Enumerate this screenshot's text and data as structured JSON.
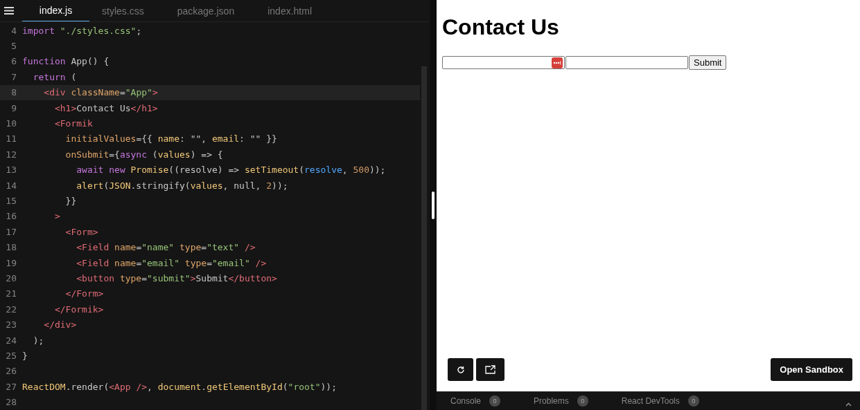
{
  "editor": {
    "tabs": [
      {
        "label": "index.js",
        "selected": true
      },
      {
        "label": "styles.css",
        "selected": false
      },
      {
        "label": "package.json",
        "selected": false
      },
      {
        "label": "index.html",
        "selected": false
      }
    ],
    "lines": [
      {
        "number": "4",
        "highlighted": false,
        "tokens": [
          {
            "text": "import ",
            "kind": "kw"
          },
          {
            "text": "\"./styles.css\"",
            "kind": "str"
          },
          {
            "text": ";",
            "kind": "plain"
          }
        ]
      },
      {
        "number": "5",
        "highlighted": false
      },
      {
        "number": "6",
        "highlighted": false,
        "tokens": [
          {
            "text": "function",
            "kind": "kw"
          },
          {
            "text": " App() {",
            "kind": "plain"
          }
        ]
      },
      {
        "number": "7",
        "highlighted": false,
        "tokens": [
          {
            "text": "  return",
            "kind": "kw"
          },
          {
            "text": " (",
            "kind": "plain"
          }
        ]
      },
      {
        "number": "8",
        "highlighted": true,
        "tokens": [
          {
            "text": "    <div",
            "kind": "tag"
          },
          {
            "text": " className",
            "kind": "attr"
          },
          {
            "text": "=",
            "kind": "plain"
          },
          {
            "text": "\"App\"",
            "kind": "str"
          },
          {
            "text": ">",
            "kind": "tag"
          }
        ]
      },
      {
        "number": "9",
        "highlighted": false,
        "tokens": [
          {
            "text": "      <h1>",
            "kind": "tag"
          },
          {
            "text": "Contact Us",
            "kind": "plain"
          },
          {
            "text": "</h1>",
            "kind": "tag"
          }
        ]
      },
      {
        "number": "10",
        "highlighted": false,
        "tokens": [
          {
            "text": "      <Formik",
            "kind": "tag"
          }
        ]
      },
      {
        "number": "11",
        "highlighted": false,
        "tokens": [
          {
            "text": "        initialValues",
            "kind": "attr"
          },
          {
            "text": "={{ ",
            "kind": "plain"
          },
          {
            "text": "name",
            "kind": "fn"
          },
          {
            "text": ": \"\", ",
            "kind": "plain"
          },
          {
            "text": "email",
            "kind": "fn"
          },
          {
            "text": ": \"\" }}",
            "kind": "plain"
          }
        ]
      },
      {
        "number": "12",
        "highlighted": false,
        "tokens": [
          {
            "text": "        onSubmit",
            "kind": "attr"
          },
          {
            "text": "={",
            "kind": "plain"
          },
          {
            "text": "async",
            "kind": "kw"
          },
          {
            "text": " (",
            "kind": "plain"
          },
          {
            "text": "values",
            "kind": "fn"
          },
          {
            "text": ") => {",
            "kind": "plain"
          }
        ]
      },
      {
        "number": "13",
        "highlighted": false,
        "tokens": [
          {
            "text": "          await new ",
            "kind": "kw"
          },
          {
            "text": "Promise",
            "kind": "fn"
          },
          {
            "text": "((resolve) => ",
            "kind": "plain"
          },
          {
            "text": "setTimeout",
            "kind": "fn"
          },
          {
            "text": "(",
            "kind": "plain"
          },
          {
            "text": "resolve",
            "kind": "var"
          },
          {
            "text": ", ",
            "kind": "plain"
          },
          {
            "text": "500",
            "kind": "num"
          },
          {
            "text": "));",
            "kind": "plain"
          }
        ]
      },
      {
        "number": "14",
        "highlighted": false,
        "tokens": [
          {
            "text": "          alert",
            "kind": "fn"
          },
          {
            "text": "(",
            "kind": "plain"
          },
          {
            "text": "JSON",
            "kind": "fn"
          },
          {
            "text": ".stringify(",
            "kind": "plain"
          },
          {
            "text": "values",
            "kind": "fn"
          },
          {
            "text": ", null, ",
            "kind": "plain"
          },
          {
            "text": "2",
            "kind": "num"
          },
          {
            "text": "));",
            "kind": "plain"
          }
        ]
      },
      {
        "number": "15",
        "highlighted": false,
        "tokens": [
          {
            "text": "        }}",
            "kind": "plain"
          }
        ]
      },
      {
        "number": "16",
        "highlighted": false,
        "tokens": [
          {
            "text": "      >",
            "kind": "tag"
          }
        ]
      },
      {
        "number": "17",
        "highlighted": false,
        "tokens": [
          {
            "text": "        <Form>",
            "kind": "tag"
          }
        ]
      },
      {
        "number": "18",
        "highlighted": false,
        "tokens": [
          {
            "text": "          <Field",
            "kind": "tag"
          },
          {
            "text": " name",
            "kind": "attr"
          },
          {
            "text": "=",
            "kind": "plain"
          },
          {
            "text": "\"name\"",
            "kind": "str"
          },
          {
            "text": " type",
            "kind": "attr"
          },
          {
            "text": "=",
            "kind": "plain"
          },
          {
            "text": "\"text\"",
            "kind": "str"
          },
          {
            "text": " />",
            "kind": "tag"
          }
        ]
      },
      {
        "number": "19",
        "highlighted": false,
        "tokens": [
          {
            "text": "          <Field",
            "kind": "tag"
          },
          {
            "text": " name",
            "kind": "attr"
          },
          {
            "text": "=",
            "kind": "plain"
          },
          {
            "text": "\"email\"",
            "kind": "str"
          },
          {
            "text": " type",
            "kind": "attr"
          },
          {
            "text": "=",
            "kind": "plain"
          },
          {
            "text": "\"email\"",
            "kind": "str"
          },
          {
            "text": " />",
            "kind": "tag"
          }
        ]
      },
      {
        "number": "20",
        "highlighted": false,
        "tokens": [
          {
            "text": "          <button",
            "kind": "tag"
          },
          {
            "text": " type",
            "kind": "attr"
          },
          {
            "text": "=",
            "kind": "plain"
          },
          {
            "text": "\"submit\"",
            "kind": "str"
          },
          {
            "text": ">",
            "kind": "tag"
          },
          {
            "text": "Submit",
            "kind": "plain"
          },
          {
            "text": "</button>",
            "kind": "tag"
          }
        ]
      },
      {
        "number": "21",
        "highlighted": false,
        "tokens": [
          {
            "text": "        </Form>",
            "kind": "tag"
          }
        ]
      },
      {
        "number": "22",
        "highlighted": false,
        "tokens": [
          {
            "text": "      </Formik>",
            "kind": "tag"
          }
        ]
      },
      {
        "number": "23",
        "highlighted": false,
        "tokens": [
          {
            "text": "    </div>",
            "kind": "tag"
          }
        ]
      },
      {
        "number": "24",
        "highlighted": false,
        "tokens": [
          {
            "text": "  );",
            "kind": "plain"
          }
        ]
      },
      {
        "number": "25",
        "highlighted": false,
        "tokens": [
          {
            "text": "}",
            "kind": "plain"
          }
        ]
      },
      {
        "number": "26",
        "highlighted": false
      },
      {
        "number": "27",
        "highlighted": false,
        "tokens": [
          {
            "text": "ReactDOM",
            "kind": "fn"
          },
          {
            "text": ".render(",
            "kind": "plain"
          },
          {
            "text": "<App />",
            "kind": "tag"
          },
          {
            "text": ", ",
            "kind": "plain"
          },
          {
            "text": "document",
            "kind": "fn"
          },
          {
            "text": ".",
            "kind": "plain"
          },
          {
            "text": "getElementById",
            "kind": "fn"
          },
          {
            "text": "(",
            "kind": "plain"
          },
          {
            "text": "\"root\"",
            "kind": "str"
          },
          {
            "text": "));",
            "kind": "plain"
          }
        ]
      },
      {
        "number": "28",
        "highlighted": false
      }
    ]
  },
  "preview": {
    "heading": "Contact Us",
    "submit_label": "Submit",
    "open_sandbox": "Open Sandbox"
  },
  "bottom_tabs": [
    {
      "label": "Console",
      "count": "0"
    },
    {
      "label": "Problems",
      "count": "0"
    },
    {
      "label": "React DevTools",
      "count": "0"
    }
  ]
}
